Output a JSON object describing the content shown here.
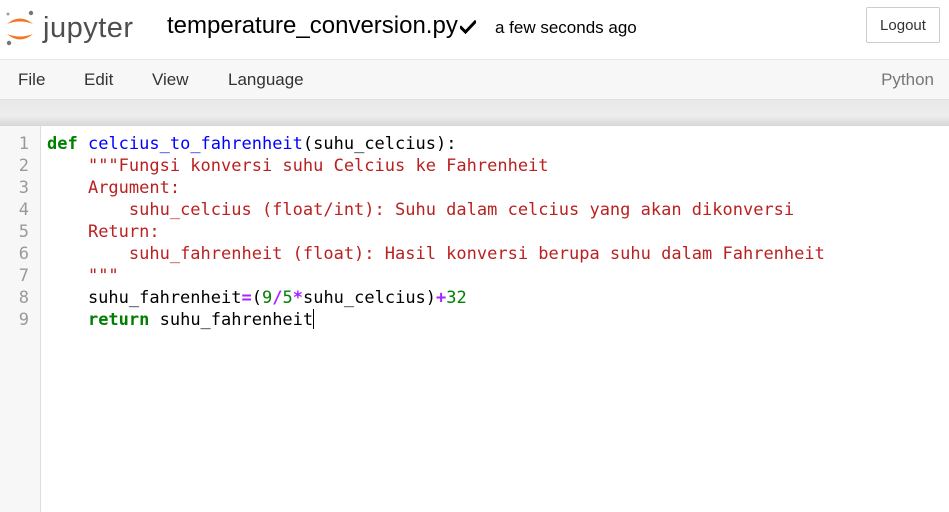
{
  "header": {
    "logo_text": "jupyter",
    "filename": "temperature_conversion.py",
    "save_status": "a few seconds ago",
    "logout_label": "Logout"
  },
  "menubar": {
    "items": [
      "File",
      "Edit",
      "View",
      "Language"
    ],
    "language_indicator": "Python"
  },
  "editor": {
    "line_numbers": [
      "1",
      "2",
      "3",
      "4",
      "5",
      "6",
      "7",
      "8",
      "9"
    ],
    "lines": [
      [
        {
          "t": "def",
          "c": "kw"
        },
        {
          "t": " ",
          "c": ""
        },
        {
          "t": "celcius_to_fahrenheit",
          "c": "fn"
        },
        {
          "t": "(suhu_celcius):",
          "c": ""
        }
      ],
      [
        {
          "t": "    ",
          "c": ""
        },
        {
          "t": "\"\"\"Fungsi konversi suhu Celcius ke Fahrenheit",
          "c": "str"
        }
      ],
      [
        {
          "t": "    ",
          "c": ""
        },
        {
          "t": "Argument:",
          "c": "str"
        }
      ],
      [
        {
          "t": "        ",
          "c": ""
        },
        {
          "t": "suhu_celcius (float/int): Suhu dalam celcius yang akan dikonversi",
          "c": "str"
        }
      ],
      [
        {
          "t": "    ",
          "c": ""
        },
        {
          "t": "Return:",
          "c": "str"
        }
      ],
      [
        {
          "t": "        ",
          "c": ""
        },
        {
          "t": "suhu_fahrenheit (float): Hasil konversi berupa suhu dalam Fahrenheit",
          "c": "str"
        }
      ],
      [
        {
          "t": "    ",
          "c": ""
        },
        {
          "t": "\"\"\"",
          "c": "str"
        }
      ],
      [
        {
          "t": "    suhu_fahrenheit",
          "c": ""
        },
        {
          "t": "=",
          "c": "op"
        },
        {
          "t": "(",
          "c": ""
        },
        {
          "t": "9",
          "c": "num"
        },
        {
          "t": "/",
          "c": "op"
        },
        {
          "t": "5",
          "c": "num"
        },
        {
          "t": "*",
          "c": "op"
        },
        {
          "t": "suhu_celcius)",
          "c": ""
        },
        {
          "t": "+",
          "c": "op"
        },
        {
          "t": "32",
          "c": "num"
        }
      ],
      [
        {
          "t": "    ",
          "c": ""
        },
        {
          "t": "return",
          "c": "kw"
        },
        {
          "t": " suhu_fahrenheit",
          "c": ""
        }
      ]
    ]
  },
  "colors": {
    "keyword": "#008000",
    "function": "#0000ff",
    "string": "#ba2121",
    "operator": "#aa22ff",
    "number": "#008000",
    "logo_orange": "#f37726"
  }
}
